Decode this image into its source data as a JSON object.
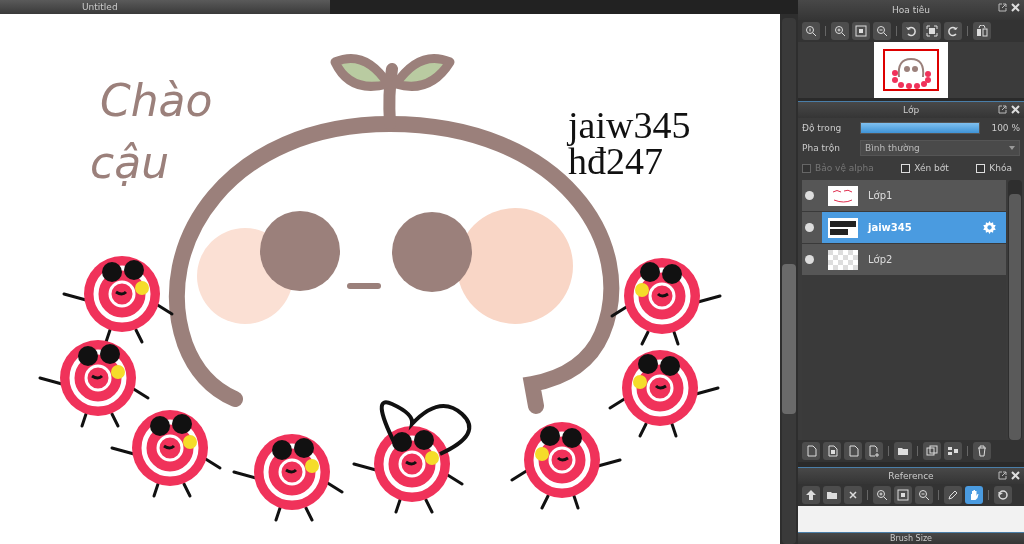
{
  "document_tab": {
    "title": "Untitled"
  },
  "canvas": {
    "texts": [
      {
        "kind": "handwritten",
        "lines": [
          "Chào",
          "cậu"
        ]
      },
      {
        "kind": "serif",
        "lines": [
          "jaiw345",
          "hđ247"
        ]
      }
    ]
  },
  "navigator": {
    "title": "Hoa tiêu"
  },
  "layers_panel": {
    "title": "Lớp",
    "opacity": {
      "label": "Độ trong",
      "level": 1,
      "reading": "100 %"
    },
    "blend": {
      "label": "Pha trộn",
      "value": "Bình thường"
    },
    "options": [
      {
        "label": "Bảo vệ alpha",
        "checked": false,
        "disabled": true
      },
      {
        "label": "Xén bớt",
        "checked": false,
        "disabled": false
      },
      {
        "label": "Khóa",
        "checked": false,
        "disabled": false
      }
    ],
    "layers": [
      {
        "name": "Lớp1",
        "selected": false,
        "kind": "sketch"
      },
      {
        "name": "jaiw345",
        "selected": true,
        "kind": "text"
      },
      {
        "name": "Lớp2",
        "selected": false,
        "kind": "blank"
      }
    ]
  },
  "reference": {
    "title": "Reference",
    "tools": [
      {
        "selected": false
      },
      {
        "selected": false
      },
      {
        "selected": false
      },
      {
        "selected": false
      },
      {
        "selected": false
      },
      {
        "selected": false
      },
      {
        "selected": false
      },
      {
        "selected": true
      },
      {
        "selected": false
      }
    ]
  },
  "brush_size": {
    "title": "Brush Size"
  }
}
